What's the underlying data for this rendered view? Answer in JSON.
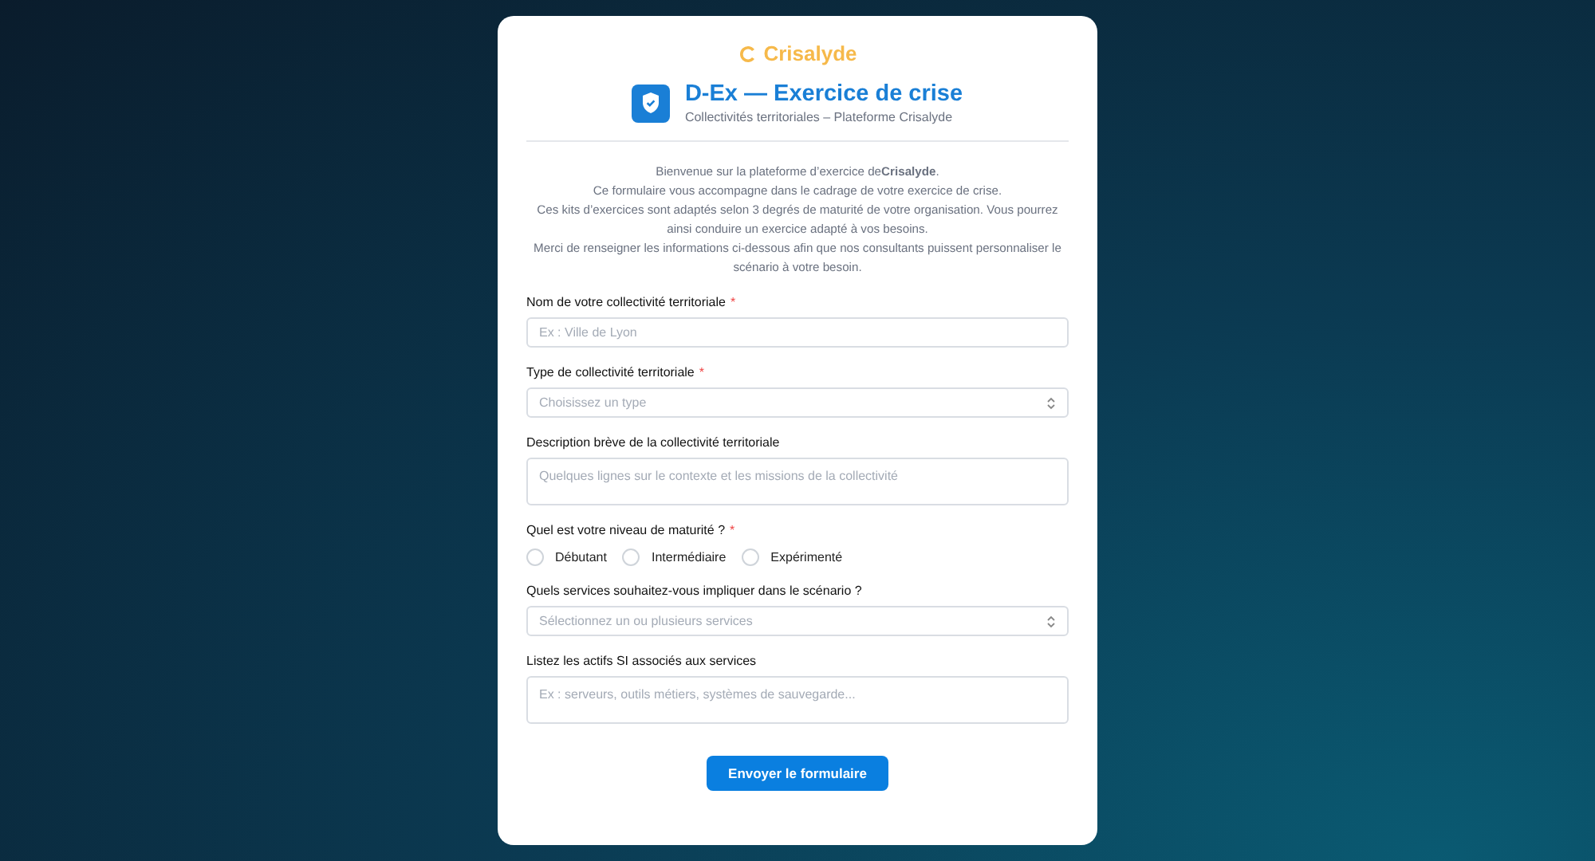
{
  "logo": {
    "name": "Crisalyde"
  },
  "header": {
    "title": "D-Ex — Exercice de crise",
    "subtitle": "Collectivités territoriales – Plateforme Crisalyde"
  },
  "intro": [
    "Bienvenue sur la plateforme d’exercice de**Crisalyde**.",
    "Ce formulaire vous accompagne dans le cadrage de votre exercice de crise.",
    "Ces kits d’exercices sont adaptés selon 3 degrés de maturité de votre organisation. Vous pourrez ainsi conduire un exercice adapté à vos besoins.",
    "Merci de renseigner les informations ci-dessous afin que nos consultants puissent personnaliser le scénario à votre besoin."
  ],
  "fields": [
    {
      "kind": "input",
      "label": "Nom de votre collectivité territoriale",
      "required_mark": "*",
      "placeholder": "Ex : Ville de Lyon"
    },
    {
      "kind": "select",
      "label": "Type de collectivité territoriale",
      "required_mark": "*",
      "placeholder": "Choisissez un type"
    },
    {
      "kind": "textarea",
      "label": "Description brève de la collectivité territoriale",
      "placeholder": "Quelques lignes sur le contexte et les missions de la collectivité"
    },
    {
      "kind": "radio",
      "label": "Quel est votre niveau de maturité ?",
      "required_mark": "*",
      "options": [
        {
          "label": "Débutant",
          "selected": false
        },
        {
          "label": "Intermédiaire",
          "selected": false
        },
        {
          "label": "Expérimenté",
          "selected": false
        }
      ]
    },
    {
      "kind": "select",
      "label": "Quels services souhaitez-vous impliquer dans le scénario ?",
      "placeholder": "Sélectionnez un ou plusieurs services"
    },
    {
      "kind": "textarea",
      "label": "Listez les actifs SI associés aux services",
      "placeholder": "Ex : serveurs, outils métiers, systèmes de sauvegarde..."
    }
  ],
  "submit": "Envoyer le formulaire"
}
